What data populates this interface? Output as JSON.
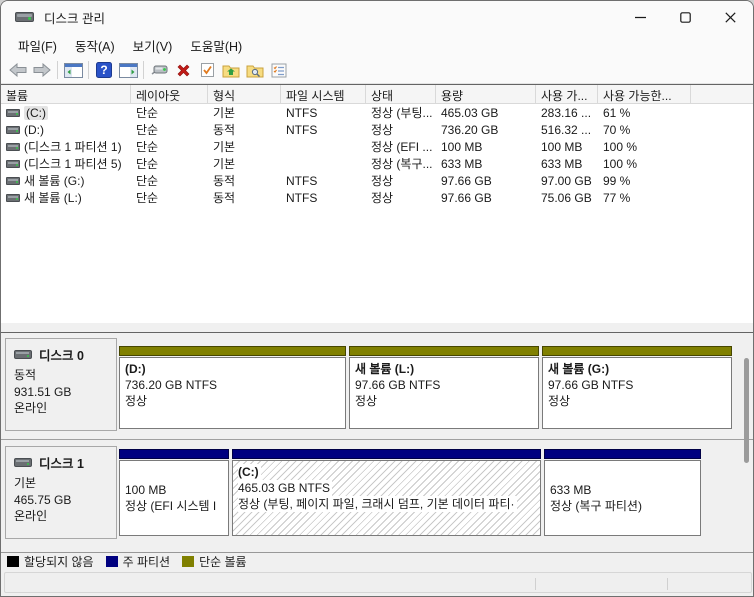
{
  "window": {
    "title": "디스크 관리",
    "controls": {
      "minimize": "minimize",
      "maximize": "maximize",
      "close": "close"
    }
  },
  "menu": {
    "items": [
      {
        "label": "파일(F)"
      },
      {
        "label": "동작(A)"
      },
      {
        "label": "보기(V)"
      },
      {
        "label": "도움말(H)"
      }
    ]
  },
  "toolbar": {
    "icons": [
      "back-icon",
      "forward-icon",
      "console-tree-icon",
      "help-icon",
      "action-pane-icon",
      "rescan-disks-icon",
      "delete-icon",
      "check-document-icon",
      "folder-up-icon",
      "folder-search-icon",
      "properties-icon"
    ],
    "help_glyph": "?"
  },
  "volume_table": {
    "columns": [
      "볼륨",
      "레이아웃",
      "형식",
      "파일 시스템",
      "상태",
      "용량",
      "사용 가...",
      "사용 가능한..."
    ],
    "rows": [
      {
        "volume": "(C:)",
        "layout": "단순",
        "type": "기본",
        "fs": "NTFS",
        "status": "정상 (부팅...",
        "capacity": "465.03 GB",
        "free": "283.16 ...",
        "pct": "61 %"
      },
      {
        "volume": "(D:)",
        "layout": "단순",
        "type": "동적",
        "fs": "NTFS",
        "status": "정상",
        "capacity": "736.20 GB",
        "free": "516.32 ...",
        "pct": "70 %"
      },
      {
        "volume": "(디스크 1 파티션 1)",
        "layout": "단순",
        "type": "기본",
        "fs": "",
        "status": "정상 (EFI ...",
        "capacity": "100 MB",
        "free": "100 MB",
        "pct": "100 %"
      },
      {
        "volume": "(디스크 1 파티션 5)",
        "layout": "단순",
        "type": "기본",
        "fs": "",
        "status": "정상 (복구...",
        "capacity": "633 MB",
        "free": "633 MB",
        "pct": "100 %"
      },
      {
        "volume": "새 볼륨 (G:)",
        "layout": "단순",
        "type": "동적",
        "fs": "NTFS",
        "status": "정상",
        "capacity": "97.66 GB",
        "free": "97.00 GB",
        "pct": "99 %"
      },
      {
        "volume": "새 볼륨 (L:)",
        "layout": "단순",
        "type": "동적",
        "fs": "NTFS",
        "status": "정상",
        "capacity": "97.66 GB",
        "free": "75.06 GB",
        "pct": "77 %"
      }
    ]
  },
  "disks": [
    {
      "title": "디스크 0",
      "type": "동적",
      "size": "931.51 GB",
      "status": "온라인",
      "partitions": [
        {
          "name": "(D:)",
          "info": "736.20 GB NTFS",
          "status": "정상"
        },
        {
          "name": "새 볼륨  (L:)",
          "info": "97.66 GB NTFS",
          "status": "정상"
        },
        {
          "name": "새 볼륨  (G:)",
          "info": "97.66 GB NTFS",
          "status": "정상"
        }
      ]
    },
    {
      "title": "디스크 1",
      "type": "기본",
      "size": "465.75 GB",
      "status": "온라인",
      "partitions": [
        {
          "name": "",
          "info": "100 MB",
          "status": "정상 (EFI 시스템 I"
        },
        {
          "name": "(C:)",
          "info": "465.03 GB NTFS",
          "status": "정상 (부팅, 페이지 파일, 크래시 덤프, 기본 데이터 파티·"
        },
        {
          "name": "",
          "info": "633 MB",
          "status": "정상 (복구 파티션)"
        }
      ]
    }
  ],
  "legend": {
    "items": [
      {
        "label": "할당되지 않음",
        "color": "#000000"
      },
      {
        "label": "주 파티션",
        "color": "#000080"
      },
      {
        "label": "단순 볼륨",
        "color": "#808000"
      }
    ]
  },
  "colors": {
    "simple_volume": "#808000",
    "primary_partition": "#000080",
    "unallocated": "#000000"
  }
}
